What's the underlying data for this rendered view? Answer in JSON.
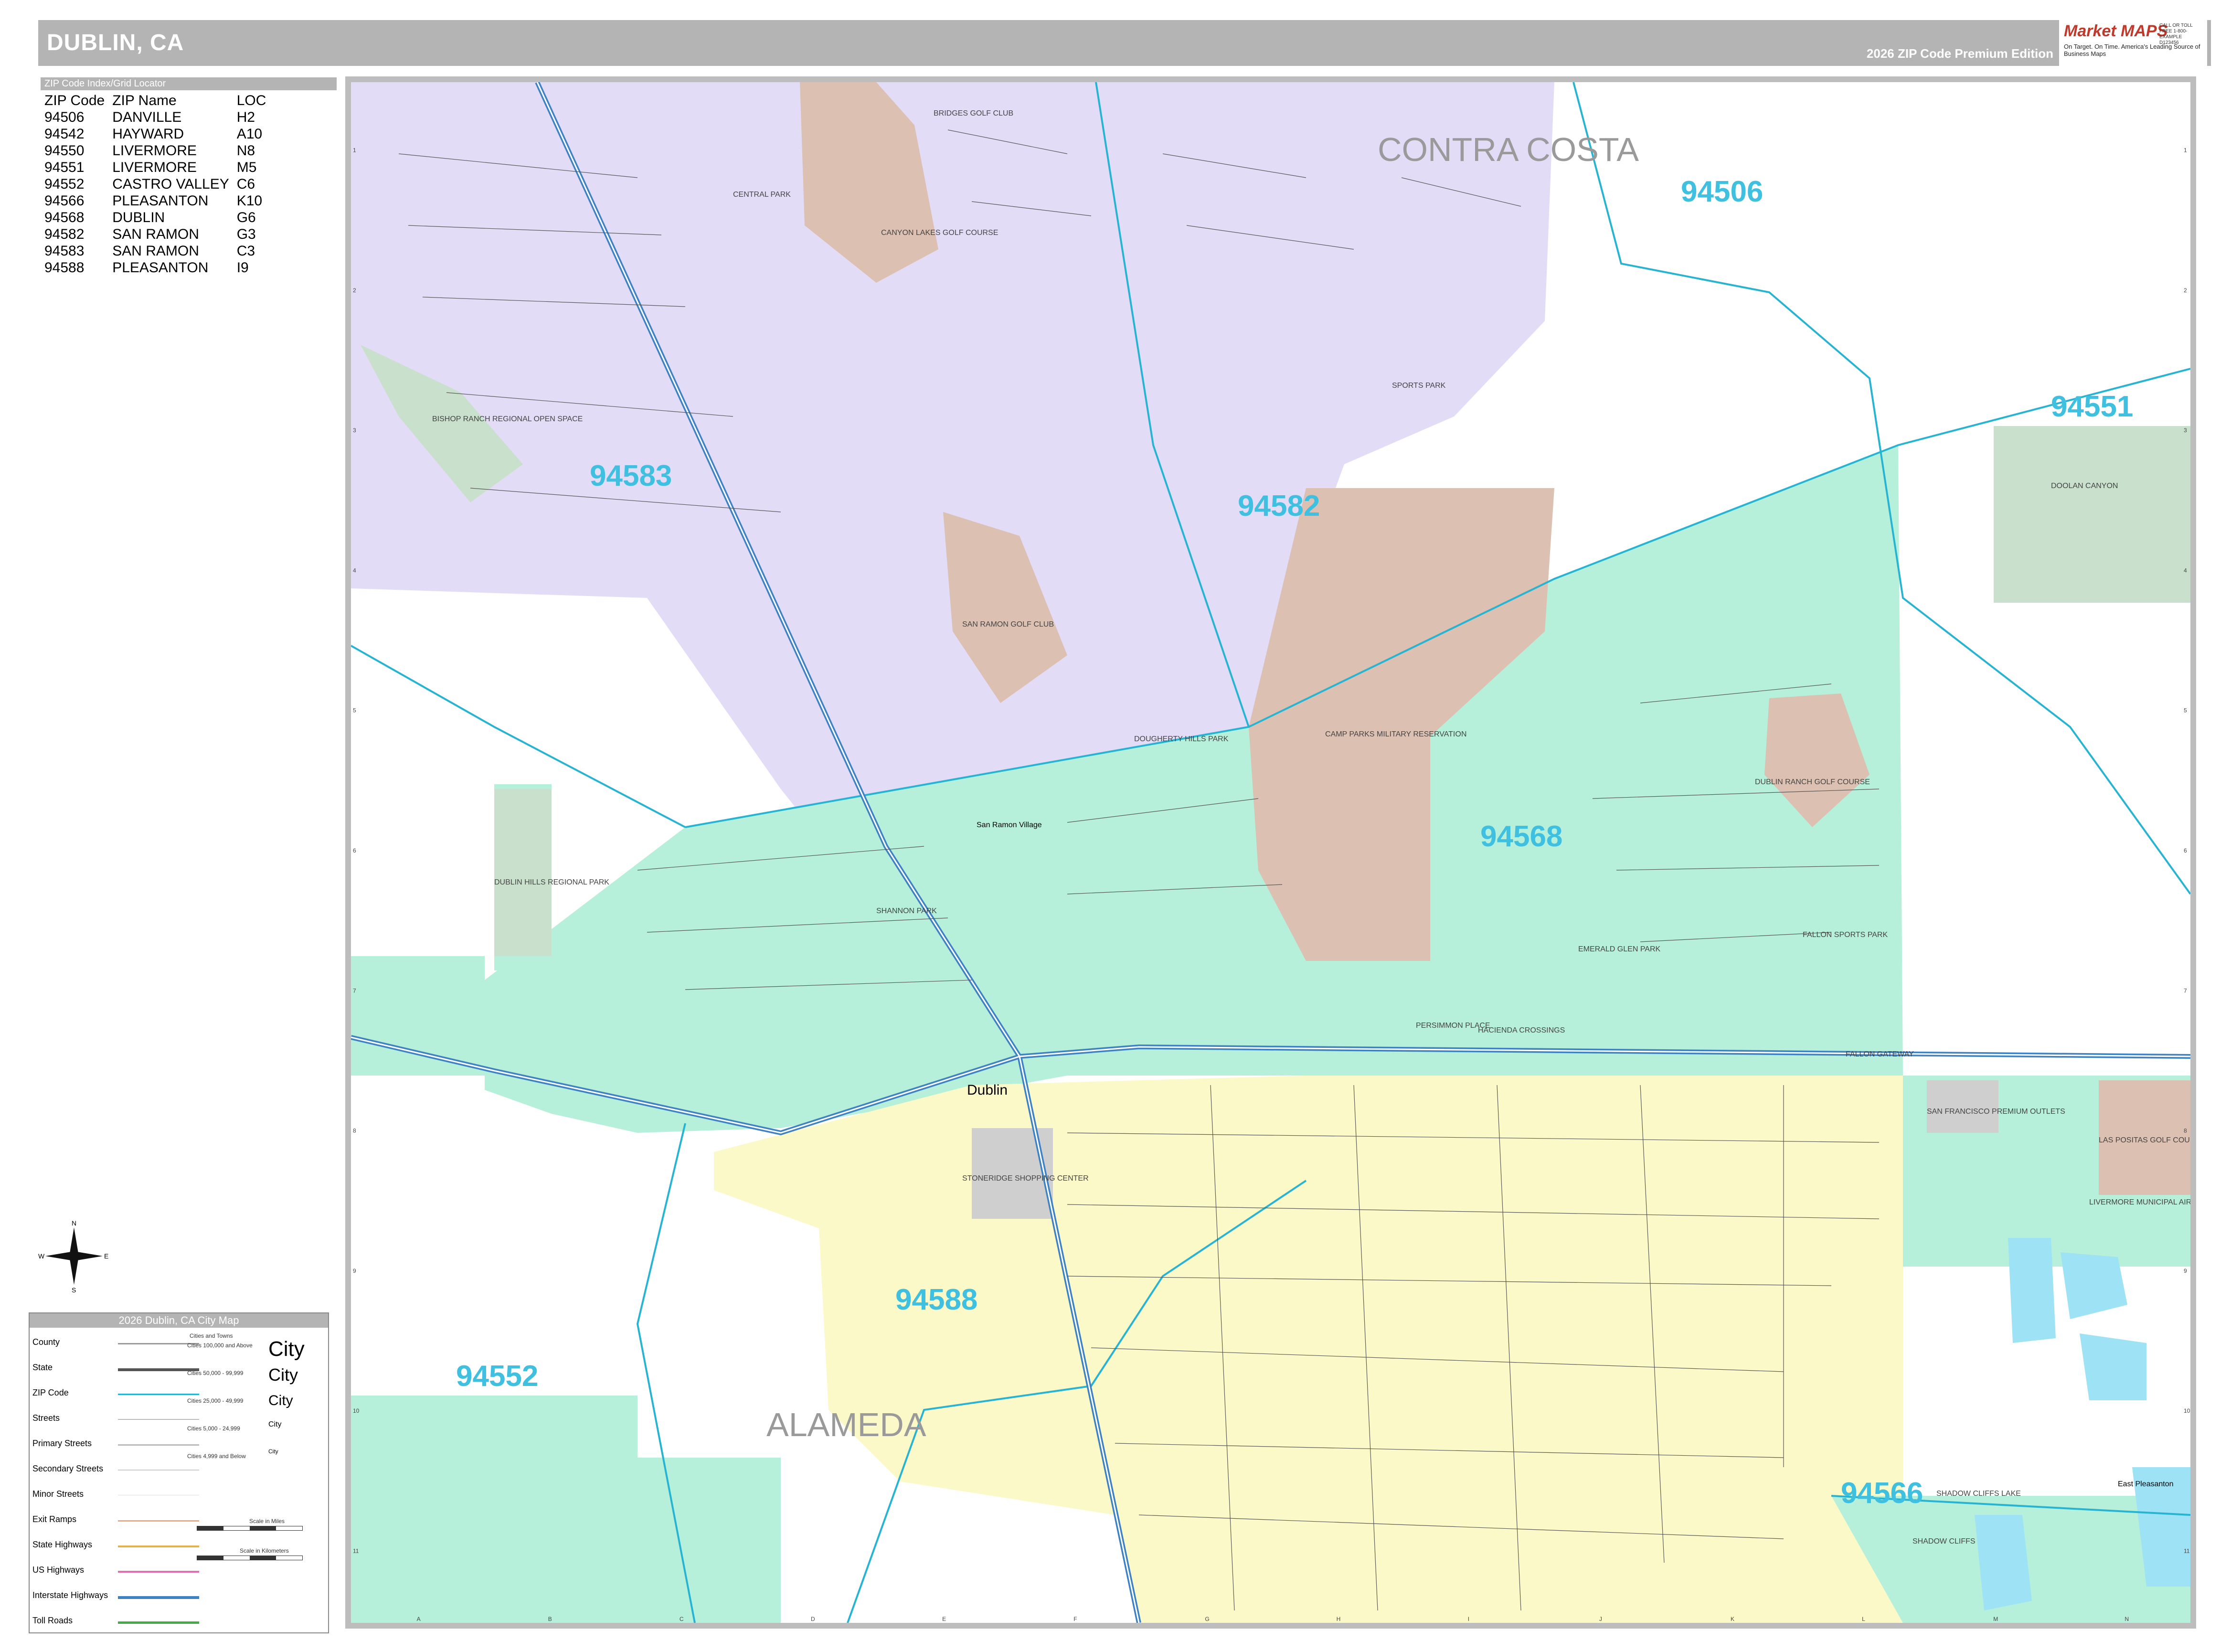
{
  "header": {
    "title": "DUBLIN, CA",
    "edition": "2026 ZIP Code Premium Edition",
    "logo_brand": "Market MAPS",
    "logo_tagline": "On Target. On Time. America's Leading Source of Business Maps",
    "logo_contact": "CALL OR TOLL FREE 1-800-EXAMPLE",
    "logo_code": "D123456"
  },
  "zip_index": {
    "header": "ZIP Code Index/Grid Locator",
    "columns": [
      "ZIP Code",
      "ZIP Name",
      "LOC"
    ],
    "rows": [
      [
        "94506",
        "DANVILLE",
        "H2"
      ],
      [
        "94542",
        "HAYWARD",
        "A10"
      ],
      [
        "94550",
        "LIVERMORE",
        "N8"
      ],
      [
        "94551",
        "LIVERMORE",
        "M5"
      ],
      [
        "94552",
        "CASTRO VALLEY",
        "C6"
      ],
      [
        "94566",
        "PLEASANTON",
        "K10"
      ],
      [
        "94568",
        "DUBLIN",
        "G6"
      ],
      [
        "94582",
        "SAN RAMON",
        "G3"
      ],
      [
        "94583",
        "SAN RAMON",
        "C3"
      ],
      [
        "94588",
        "PLEASANTON",
        "I9"
      ]
    ]
  },
  "grid": {
    "columns": [
      "A",
      "B",
      "C",
      "D",
      "E",
      "F",
      "G",
      "H",
      "I",
      "J",
      "K",
      "L",
      "M",
      "N"
    ],
    "rows": [
      "1",
      "2",
      "3",
      "4",
      "5",
      "6",
      "7",
      "8",
      "9",
      "10",
      "11"
    ]
  },
  "map": {
    "counties": [
      "CONTRA COSTA",
      "ALAMEDA"
    ],
    "zip_labels": [
      "94506",
      "94551",
      "94583",
      "94582",
      "94568",
      "94588",
      "94552",
      "94566"
    ],
    "cities": [
      "Dublin",
      "San Ramon Village",
      "East Pleasanton"
    ],
    "features": [
      "BRIDGES GOLF CLUB",
      "CANYON LAKES GOLF COURSE",
      "CENTRAL PARK",
      "BISHOP RANCH REGIONAL OPEN SPACE",
      "SAN RAMON GOLF CLUB",
      "CAMP PARKS MILITARY RESERVATION",
      "DUBLIN RANCH GOLF COURSE",
      "DOOLAN CANYON",
      "DUBLIN HILLS REGIONAL PARK",
      "FALLON SPORTS PARK",
      "EMERALD GLEN PARK",
      "HACIENDA CROSSINGS",
      "PERSIMMON PLACE",
      "FALLON GATEWAY",
      "STONERIDGE SHOPPING CENTER",
      "SAN FRANCISCO PREMIUM OUTLETS",
      "LAS POSITAS GOLF COURSE",
      "LIVERMORE MUNICIPAL AIRPORT",
      "SHADOW CLIFFS LAKE",
      "SHADOW CLIFFS",
      "SPORTS PARK",
      "DOUGHERTY HILLS PARK",
      "SHANNON PARK"
    ],
    "colors": {
      "zip_94583_94582": "#e3dcf7",
      "zip_94568_94552": "#b6f0da",
      "zip_94588_94566": "#fbf9c8",
      "military_golf": "#dcc0b2",
      "park": "#c9e0cc",
      "water": "#9ee2f5",
      "zip_boundary": "#27b4d3",
      "zip_label": "#3fc0e0",
      "interstate": "#3e82c4"
    }
  },
  "compass": {
    "n": "N",
    "s": "S",
    "e": "E",
    "w": "W"
  },
  "legend": {
    "title": "2026 Dublin, CA City Map",
    "items": [
      "County",
      "State",
      "ZIP Code",
      "Streets",
      "Primary Streets",
      "Secondary Streets",
      "Minor Streets",
      "Exit Ramps",
      "State Highways",
      "US Highways",
      "Interstate Highways",
      "Toll Roads"
    ],
    "cities_header": "Cities and Towns",
    "city_classes": [
      {
        "label": "Cities 100,000 and Above",
        "sample": "City"
      },
      {
        "label": "Cities 50,000 - 99,999",
        "sample": "City"
      },
      {
        "label": "Cities 25,000 - 49,999",
        "sample": "City"
      },
      {
        "label": "Cities 5,000 - 24,999",
        "sample": "City"
      },
      {
        "label": "Cities 4,999 and Below",
        "sample": "City"
      }
    ],
    "scale_miles": "Scale in Miles",
    "scale_km": "Scale in Kilometers"
  }
}
